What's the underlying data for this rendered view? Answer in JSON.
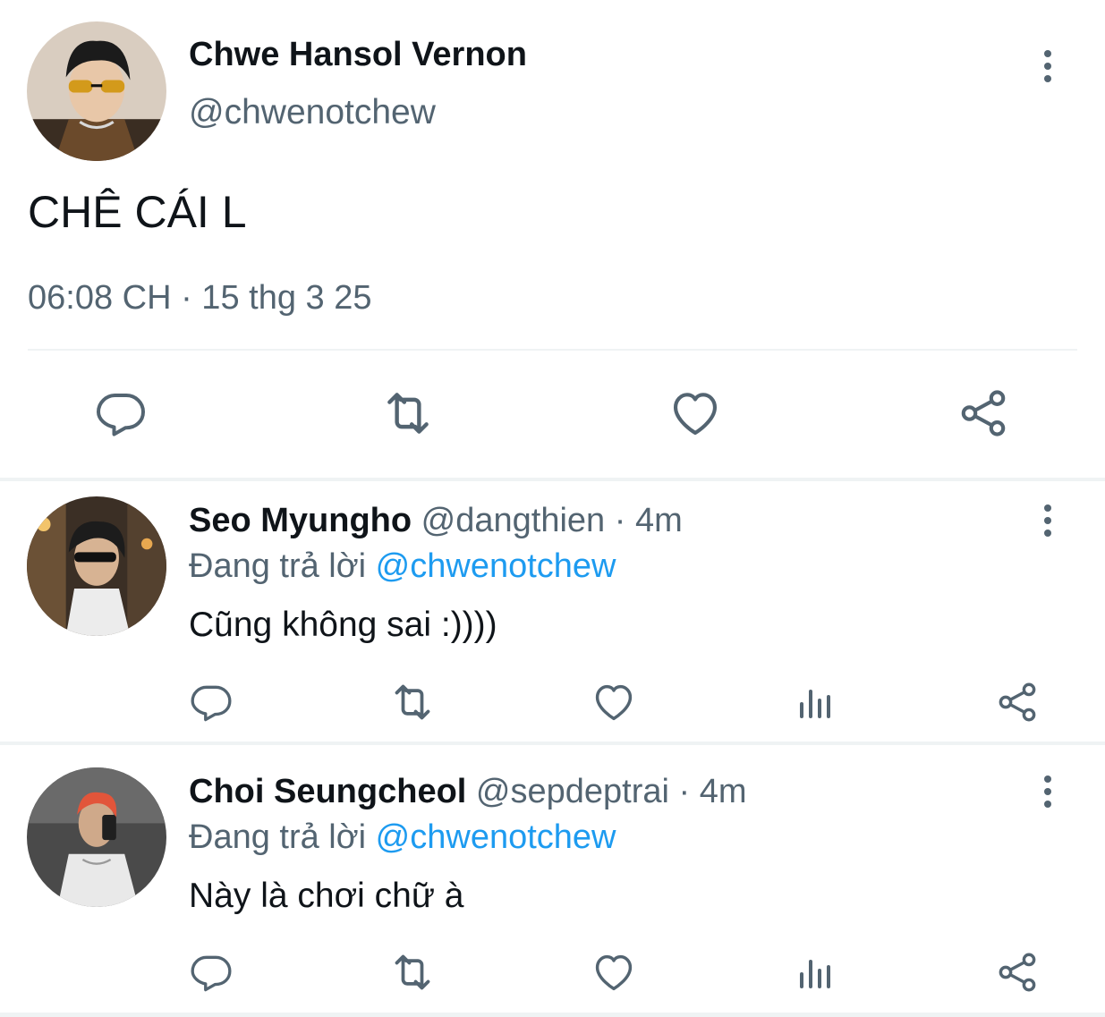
{
  "main_tweet": {
    "name": "Chwe Hansol Vernon",
    "handle": "@chwenotchew",
    "text": "CHÊ CÁI L",
    "timestamp": "06:08 CH · 15 thg 3 25",
    "actions": [
      "reply-icon",
      "retweet-icon",
      "like-icon",
      "share-icon"
    ]
  },
  "replies": [
    {
      "name": "Seo Myungho",
      "handle": "@dangthien",
      "separator": "·",
      "time": "4m",
      "replying_prefix": "Đang trả lời",
      "replying_to": "@chwenotchew",
      "text": "Cũng không sai :))))",
      "actions": [
        "reply-icon",
        "retweet-icon",
        "like-icon",
        "views-icon",
        "share-icon"
      ]
    },
    {
      "name": "Choi Seungcheol",
      "handle": "@sepdeptrai",
      "separator": "·",
      "time": "4m",
      "replying_prefix": "Đang trả lời",
      "replying_to": "@chwenotchew",
      "text": "Này là chơi chữ à",
      "actions": [
        "reply-icon",
        "retweet-icon",
        "like-icon",
        "views-icon",
        "share-icon"
      ]
    }
  ],
  "colors": {
    "text_primary": "#0f1419",
    "text_secondary": "#536471",
    "mention": "#1d9bf0",
    "divider": "#eff3f4"
  }
}
